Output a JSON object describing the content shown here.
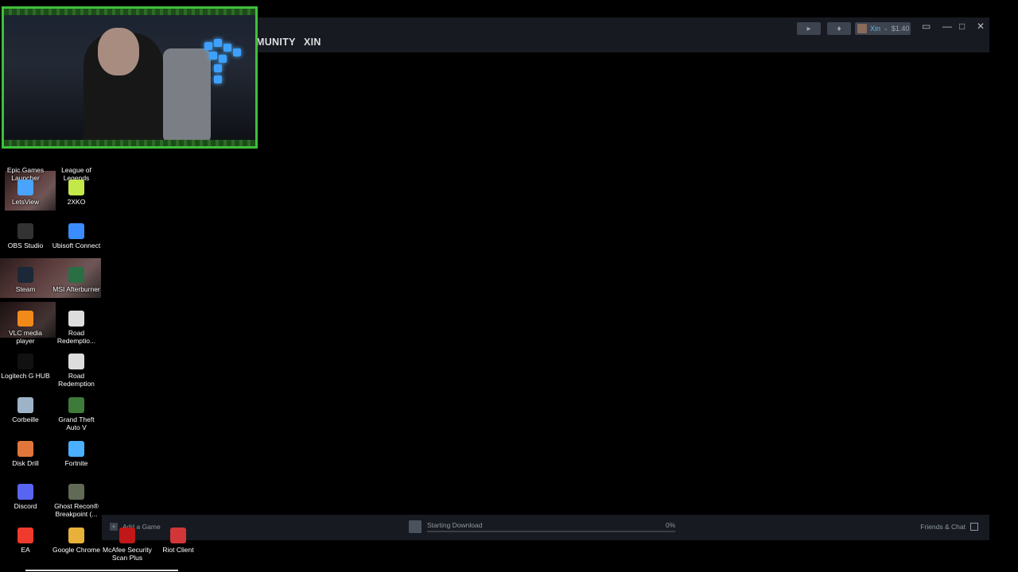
{
  "steam": {
    "nav": {
      "community_partial": "MUNITY",
      "profile": "XIN"
    },
    "titlebar": {
      "username": "Xin",
      "balance": "$1.40"
    },
    "bottom": {
      "add_game": "Add a Game",
      "download_status": "Starting Download",
      "download_percent": "0%",
      "download_progress": 0,
      "friends_chat": "Friends & Chat"
    },
    "accent_color": "#1a9fff"
  },
  "desktop_icons": [
    {
      "label": "Epic Games Launcher",
      "icon": "epic-games-icon"
    },
    {
      "label": "League of Legends",
      "icon": "league-icon"
    },
    {
      "label": "LetsView",
      "icon": "letsview-icon"
    },
    {
      "label": "2XKO",
      "icon": "2xko-icon"
    },
    {
      "label": "OBS Studio",
      "icon": "obs-icon"
    },
    {
      "label": "Ubisoft Connect",
      "icon": "ubisoft-icon"
    },
    {
      "label": "Steam",
      "icon": "steam-icon"
    },
    {
      "label": "MSI Afterburner",
      "icon": "msi-icon"
    },
    {
      "label": "VLC media player",
      "icon": "vlc-icon"
    },
    {
      "label": "Road Redemptio...",
      "icon": "road-redemption-icon"
    },
    {
      "label": "Logitech G HUB",
      "icon": "logitech-icon"
    },
    {
      "label": "Road Redemption",
      "icon": "road-redemption-icon"
    },
    {
      "label": "Corbeille",
      "icon": "recycle-bin-icon"
    },
    {
      "label": "Grand Theft Auto V",
      "icon": "gta-icon"
    },
    {
      "label": "Disk Drill",
      "icon": "disk-drill-icon"
    },
    {
      "label": "Fortnite",
      "icon": "fortnite-icon"
    },
    {
      "label": "Discord",
      "icon": "discord-icon"
    },
    {
      "label": "Ghost Recon® Breakpoint (...",
      "icon": "ghost-recon-icon"
    },
    {
      "label": "EA",
      "icon": "ea-icon"
    },
    {
      "label": "Google Chrome",
      "icon": "chrome-icon"
    },
    {
      "label": "McAfee Security Scan Plus",
      "icon": "mcafee-icon"
    },
    {
      "label": "Riot Client",
      "icon": "riot-icon"
    }
  ]
}
